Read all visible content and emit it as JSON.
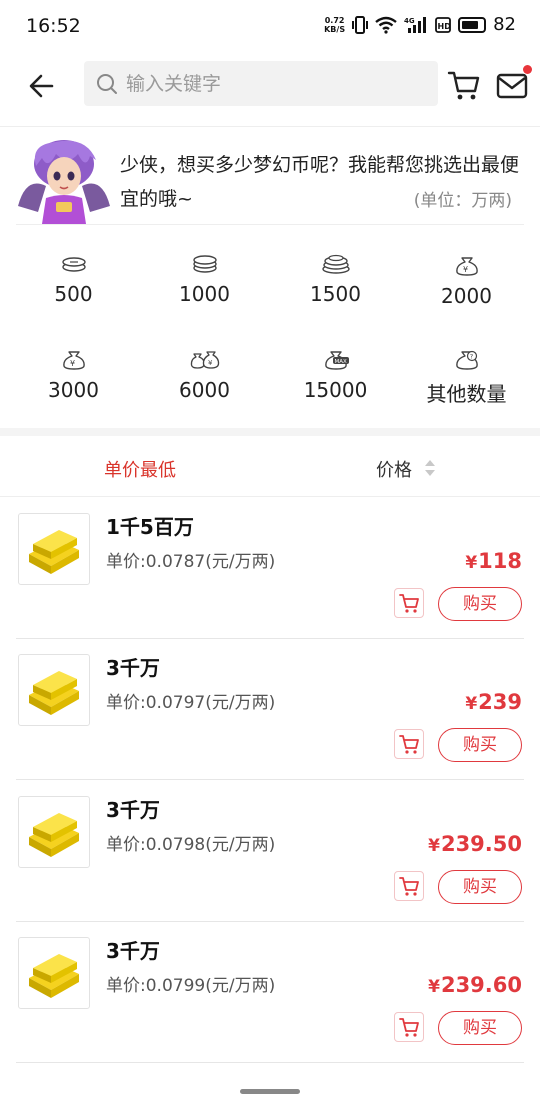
{
  "status_bar": {
    "time": "16:52",
    "speed_value": "0.72",
    "speed_unit": "KB/S",
    "battery": "82"
  },
  "search": {
    "placeholder": "输入关键字"
  },
  "tip": {
    "message": "少侠，想买多少梦幻币呢？我能帮您挑选出最便宜的哦~",
    "unit": "(单位：万两)"
  },
  "amounts": [
    {
      "label": "500",
      "icon": "coin-stack-small-icon"
    },
    {
      "label": "1000",
      "icon": "coin-stack-icon"
    },
    {
      "label": "1500",
      "icon": "coin-pile-icon"
    },
    {
      "label": "2000",
      "icon": "money-bag-icon"
    },
    {
      "label": "3000",
      "icon": "money-bag-icon"
    },
    {
      "label": "6000",
      "icon": "money-bags-icon"
    },
    {
      "label": "15000",
      "icon": "money-bag-max-icon"
    },
    {
      "label": "其他数量",
      "icon": "money-bag-question-icon"
    }
  ],
  "sort": {
    "lowest_unit_price": "单价最低",
    "price": "价格"
  },
  "listings": [
    {
      "title": "1千5百万",
      "unit_price": "单价:0.0787(元/万两)",
      "currency": "¥",
      "price": "118",
      "buy_label": "购买"
    },
    {
      "title": "3千万",
      "unit_price": "单价:0.0797(元/万两)",
      "currency": "¥",
      "price": "239",
      "buy_label": "购买"
    },
    {
      "title": "3千万",
      "unit_price": "单价:0.0798(元/万两)",
      "currency": "¥",
      "price": "239.50",
      "buy_label": "购买"
    },
    {
      "title": "3千万",
      "unit_price": "单价:0.0799(元/万两)",
      "currency": "¥",
      "price": "239.60",
      "buy_label": "购买"
    }
  ],
  "colors": {
    "accent": "#e0393e",
    "sort_active": "#d9342b",
    "notification_dot": "#e8353b"
  }
}
